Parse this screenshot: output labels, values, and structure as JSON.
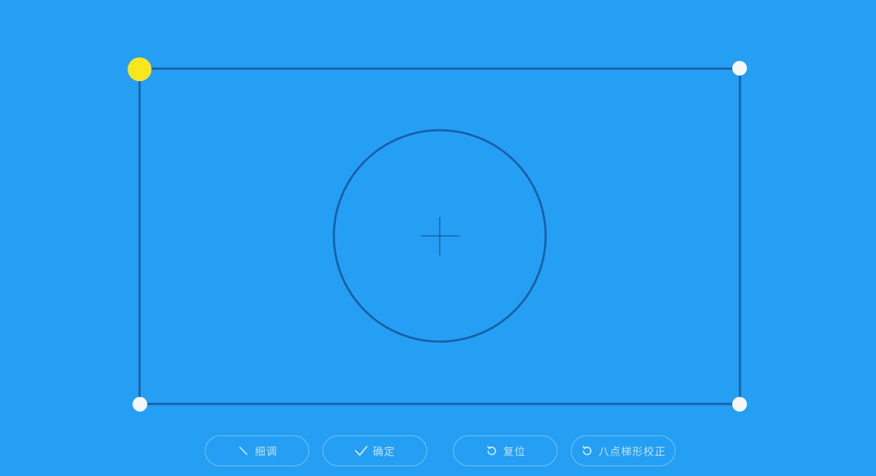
{
  "toolbar": {
    "fine_tune_label": "细调",
    "confirm_label": "确定",
    "reset_label": "复位",
    "eight_point_label": "八点梯形校正"
  },
  "colors": {
    "background": "#259ff4",
    "frame_line": "#1a5fa8",
    "active_handle": "#f9e61d",
    "inactive_handle": "#f5f7fa"
  },
  "icons": {
    "fine_tune": "diagonal-line-icon",
    "confirm": "checkmark-icon",
    "reset": "rotate-ccw-icon",
    "eight_point": "rotate-ccw-icon"
  }
}
